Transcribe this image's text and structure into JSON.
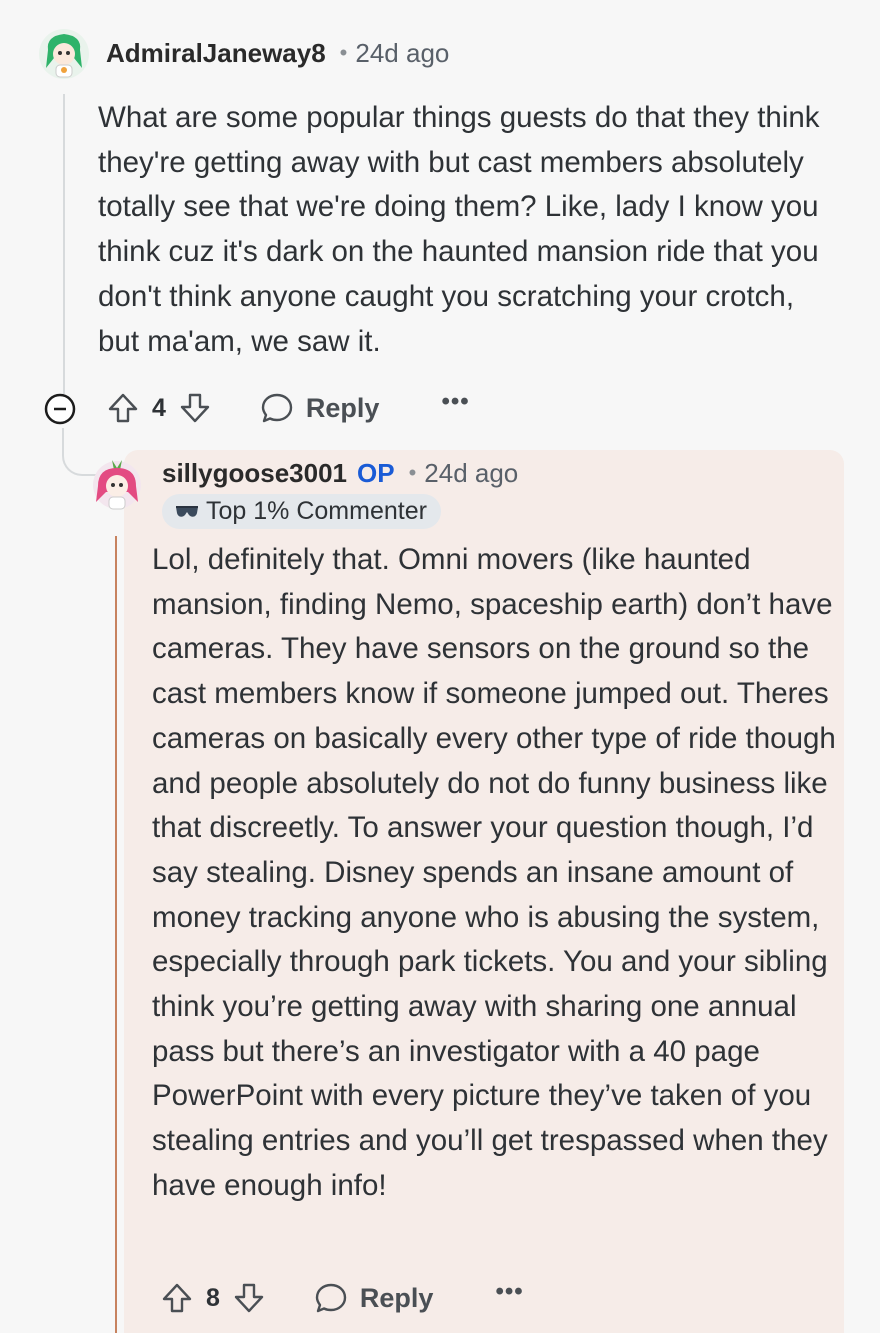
{
  "parent_comment": {
    "username": "AdmiralJaneway8",
    "age": "24d ago",
    "separator": "•",
    "body": "What are some popular things guests do that they think they're getting away with but cast members absolutely totally see that we're doing them? Like, lady I know you think cuz it's dark on the haunted mansion ride that you don't think anyone caught you scratching your crotch, but ma'am, we saw it.",
    "vote_count": "4",
    "reply_label": "Reply",
    "more_label": "•••",
    "avatar_icon": "green-haired-avatar-icon"
  },
  "reply_comment": {
    "username": "sillygoose3001",
    "op_label": "OP",
    "age": "24d ago",
    "separator": "•",
    "badge": "Top 1% Commenter",
    "body": "Lol, definitely that. Omni movers (like haunted mansion, finding Nemo, spaceship earth) don’t have cameras. They have sensors on the ground so the cast members know if someone jumped out. Theres cameras on basically every other type of ride though and people absolutely do not do funny business like that discreetly. To answer your question though, I’d say stealing. Disney spends an insane amount of money tracking anyone who is abusing the system, especially through park tickets. You and your sibling think you’re getting away with sharing one annual pass but there’s an investigator with a 40 page PowerPoint with every picture they’ve taken of you stealing entries and you’ll get trespassed when they have enough info!",
    "vote_count": "8",
    "reply_label": "Reply",
    "more_label": "•••",
    "avatar_icon": "pink-haired-avatar-icon",
    "highlight_color": "#f6ece8",
    "op_color": "#1a5bd6"
  }
}
